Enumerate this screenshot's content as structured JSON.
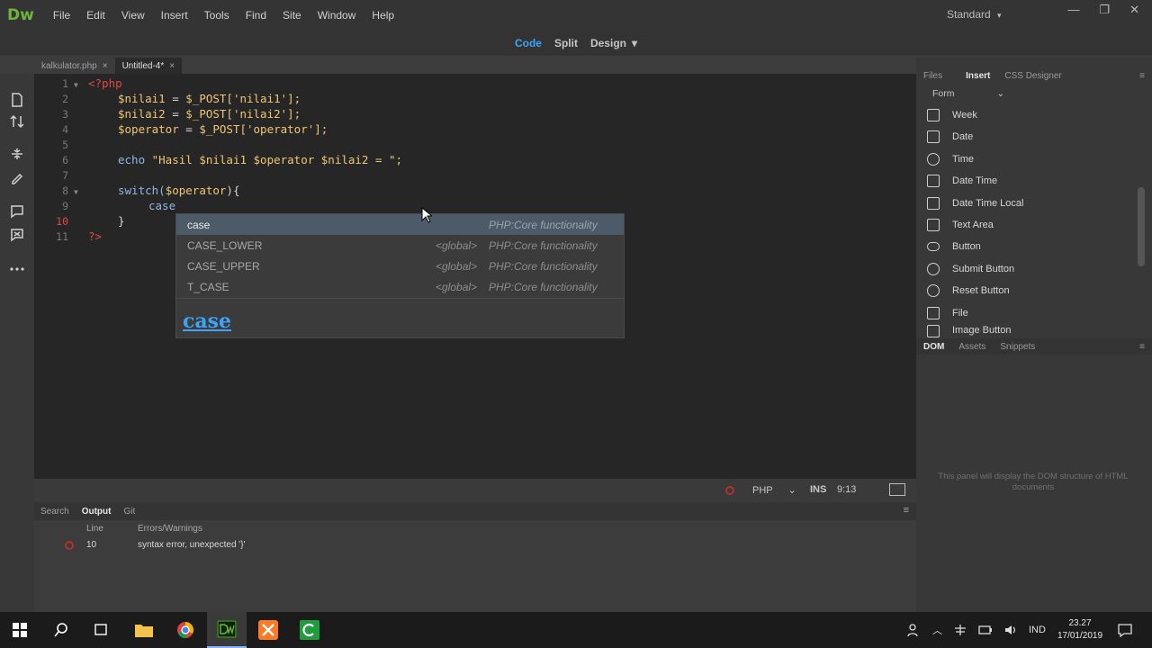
{
  "app": {
    "logo": "Dw",
    "workspace": "Standard",
    "workspace_chevron": "▾"
  },
  "menu": [
    "File",
    "Edit",
    "View",
    "Insert",
    "Tools",
    "Find",
    "Site",
    "Window",
    "Help"
  ],
  "window_controls": {
    "minimize": "—",
    "restore": "❐",
    "close": "✕"
  },
  "views": {
    "code": "Code",
    "split": "Split",
    "design": "Design",
    "chevron": "▾"
  },
  "doc_tabs": [
    {
      "name": "kalkulator.php",
      "close": "×"
    },
    {
      "name": "Untitled-4*",
      "close": "×"
    }
  ],
  "editor": {
    "lines": [
      "1",
      "2",
      "3",
      "4",
      "5",
      "6",
      "7",
      "8",
      "9",
      "10",
      "11"
    ],
    "code": {
      "l1": "<?php",
      "l2_var": "$nilai1",
      "l2_eq": " = ",
      "l2_post": "$_POST",
      "l2_rest": "['nilai1'];",
      "l3_var": "$nilai2",
      "l3_eq": " = ",
      "l3_post": "$_POST",
      "l3_rest": "['nilai2'];",
      "l4_var": "$operator",
      "l4_eq": " = ",
      "l4_post": "$_POST",
      "l4_rest": "['operator'];",
      "l6_echo": "echo",
      "l6_str": " \"Hasil $nilai1 $operator $nilai2 = \";",
      "l8_switch": "switch(",
      "l8_var": "$operator",
      "l8_rest": "){",
      "l9": "case",
      "l10": "}",
      "l11": "?>"
    }
  },
  "autocomplete": {
    "items": [
      {
        "name": "case",
        "scope": "",
        "desc": "PHP:Core functionality"
      },
      {
        "name": "CASE_LOWER",
        "scope": "<global>",
        "desc": "PHP:Core functionality"
      },
      {
        "name": "CASE_UPPER",
        "scope": "<global>",
        "desc": "PHP:Core functionality"
      },
      {
        "name": "T_CASE",
        "scope": "<global>",
        "desc": "PHP:Core functionality"
      }
    ],
    "preview": "case"
  },
  "status": {
    "language": "PHP",
    "chevron": "⌄",
    "mode": "INS",
    "position": "9:13"
  },
  "output": {
    "tabs": [
      "Search",
      "Output",
      "Git"
    ],
    "menu_icon": "≡",
    "headers": {
      "line": "Line",
      "errors": "Errors/Warnings"
    },
    "rows": [
      {
        "line": "10",
        "message": "syntax error, unexpected '}'"
      }
    ]
  },
  "right_panel": {
    "tabs": [
      "Files",
      "Insert",
      "CSS Designer"
    ],
    "menu_icon": "≡",
    "category": "Form",
    "category_chevron": "⌄",
    "insert_items": [
      "Week",
      "Date",
      "Time",
      "Date Time",
      "Date Time Local",
      "Text Area",
      "Button",
      "Submit Button",
      "Reset Button",
      "File",
      "Image Button"
    ],
    "bottom_tabs": [
      "DOM",
      "Assets",
      "Snippets"
    ],
    "dom_message": "This panel will display the DOM structure of HTML documents"
  },
  "taskbar": {
    "tray_lang": "IND",
    "time": "23.27",
    "date": "17/01/2019"
  },
  "colors": {
    "accent": "#3ea3f5",
    "logo": "#6fb33b",
    "error": "#b3312b"
  }
}
